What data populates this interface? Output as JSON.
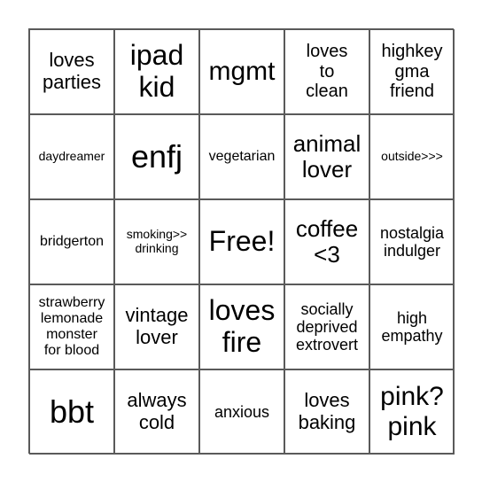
{
  "board": {
    "rows": [
      [
        "loves\nparties",
        "ipad\nkid",
        "mgmt",
        "loves\nto\nclean",
        "highkey\ngma\nfriend"
      ],
      [
        "daydreamer",
        "enfj",
        "vegetarian",
        "animal\nlover",
        "outside>>>"
      ],
      [
        "bridgerton",
        "smoking>>\ndrinking",
        "Free!",
        "coffee\n<3",
        "nostalgia\nindulger"
      ],
      [
        "strawberry\nlemonade\nmonster\nfor blood",
        "vintage\nlover",
        "loves\nfire",
        "socially\ndeprived\nextrovert",
        "high\nempathy"
      ],
      [
        "bbt",
        "always\ncold",
        "anxious",
        "loves\nbaking",
        "pink?\npink"
      ]
    ],
    "free_space": "Free!"
  }
}
